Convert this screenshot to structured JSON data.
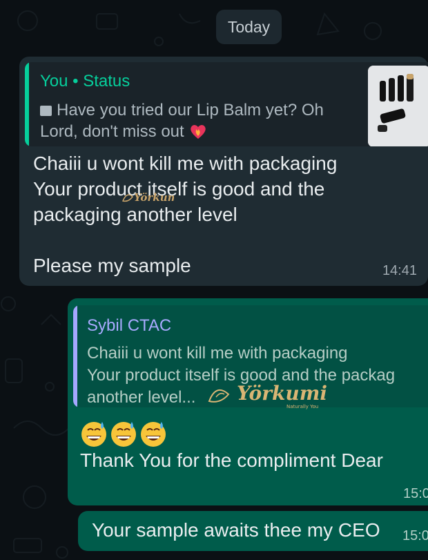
{
  "date_chip": "Today",
  "incoming": {
    "quote_author": "You • Status",
    "quote_line1": "Have you tried our Lip Balm yet? Oh",
    "quote_line2": "Lord, don't miss out",
    "quote_media_icon": "photo-icon",
    "quote_emoji_icon": "heart-on-fire-icon",
    "thumbnail": "lip-balm-product-photo",
    "lines": [
      "Chaiii u wont kill me with packaging",
      "Your product itself is good and the",
      "packaging another level",
      "Please my sample"
    ],
    "time": "14:41"
  },
  "outgoing": [
    {
      "quote_author": "Sybil CTAC",
      "quote_lines": [
        "Chaiii u wont kill me with packaging",
        "Your product itself is good and the packag",
        "another level..."
      ],
      "emoji_icon": "grinning-sweat-face-icon",
      "text": "Thank You for the compliment Dear",
      "time": "15:0"
    },
    {
      "text": "Your sample awaits thee my CEO",
      "time": "15:0"
    }
  ],
  "watermark": {
    "brand": "Yörkumi",
    "tagline": "Naturally You"
  },
  "colors": {
    "background": "#0b1014",
    "incoming_bubble": "#1f2c33",
    "outgoing_bubble": "#005c4b",
    "status_accent": "#06cf9c",
    "reply_accent": "#a5a7ff"
  }
}
